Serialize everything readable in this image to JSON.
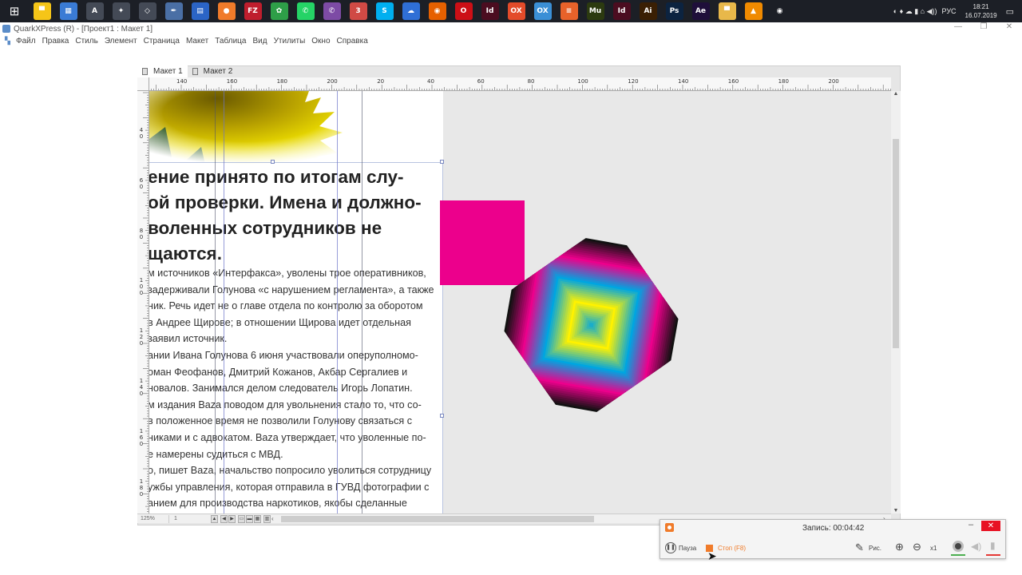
{
  "taskbar": {
    "icons": [
      {
        "name": "folder-icon",
        "color": "#f5c518",
        "glyph": "▀"
      },
      {
        "name": "tiles-icon",
        "color": "#3a7bd5",
        "glyph": "▦"
      },
      {
        "name": "a-app-icon",
        "color": "#444a56",
        "glyph": "A"
      },
      {
        "name": "gear-icon",
        "color": "#444a56",
        "glyph": "✦"
      },
      {
        "name": "cube-icon",
        "color": "#444a56",
        "glyph": "◇"
      },
      {
        "name": "feather-icon",
        "color": "#4a6fa5",
        "glyph": "✒"
      },
      {
        "name": "document-icon",
        "color": "#2b64c5",
        "glyph": "▤"
      },
      {
        "name": "recorder-app-icon",
        "color": "#f07b2a",
        "glyph": "●"
      },
      {
        "name": "filezilla-icon",
        "color": "#bf1e2d",
        "glyph": "FZ"
      },
      {
        "name": "cactus-icon",
        "color": "#2e9e48",
        "glyph": "✿"
      },
      {
        "name": "whatsapp-icon",
        "color": "#25d366",
        "glyph": "✆"
      },
      {
        "name": "viber-icon",
        "color": "#7d4ba5",
        "glyph": "✆"
      },
      {
        "name": "telegram-icon",
        "color": "#d04a45",
        "glyph": "3"
      },
      {
        "name": "skype-icon",
        "color": "#00aff0",
        "glyph": "S"
      },
      {
        "name": "cloud-icon",
        "color": "#2f6fd6",
        "glyph": "☁"
      },
      {
        "name": "firefox-icon",
        "color": "#e66000",
        "glyph": "◉"
      },
      {
        "name": "opera-icon",
        "color": "#cc0f16",
        "glyph": "O"
      },
      {
        "name": "indesign-icon",
        "color": "#4b0d20",
        "glyph": "Id"
      },
      {
        "name": "ox-icon",
        "color": "#e34b2a",
        "glyph": "OX"
      },
      {
        "name": "ox-blue-icon",
        "color": "#3b8fd6",
        "glyph": "OX"
      },
      {
        "name": "stripes-icon",
        "color": "#e8622a",
        "glyph": "≡"
      },
      {
        "name": "muse-icon",
        "color": "#2c3a10",
        "glyph": "Mu"
      },
      {
        "name": "indesign-2-icon",
        "color": "#4b0d20",
        "glyph": "Id"
      },
      {
        "name": "illustrator-icon",
        "color": "#3a1f04",
        "glyph": "Ai"
      },
      {
        "name": "photoshop-icon",
        "color": "#0c2340",
        "glyph": "Ps"
      },
      {
        "name": "after-effects-icon",
        "color": "#1f0f3a",
        "glyph": "Ae"
      },
      {
        "name": "explorer-icon",
        "color": "#e8b84a",
        "glyph": "▀"
      },
      {
        "name": "vlc-icon",
        "color": "#f08a00",
        "glyph": "▲"
      },
      {
        "name": "record-icon",
        "color": "#1c1f26",
        "glyph": "◉"
      }
    ],
    "tray": {
      "language": "РУС",
      "time": "18:21",
      "date": "16.07.2019"
    }
  },
  "window": {
    "title": "QuarkXPress (R) - [Проект1 : Макет 1]"
  },
  "menu": [
    "Файл",
    "Правка",
    "Стиль",
    "Элемент",
    "Страница",
    "Макет",
    "Таблица",
    "Вид",
    "Утилиты",
    "Окно",
    "Справка"
  ],
  "tabs": [
    "Макет 1",
    "Макет 2"
  ],
  "ruler": {
    "h_labels": [
      "140",
      "160",
      "180",
      "200",
      "20",
      "40",
      "60",
      "80",
      "100",
      "120",
      "140",
      "160",
      "180",
      "200"
    ],
    "v_labels": [
      "4 0",
      "6 0",
      "8 0",
      "1 0 0",
      "1 2 0",
      "1 4 0",
      "1 6 0",
      "1 8 0"
    ]
  },
  "article": {
    "headline": [
      "ение принято по итогам слу-",
      "ой проверки. Имена и должно-",
      "воленных сотрудников не",
      "щаются."
    ],
    "body": [
      "м источников «Интерфакса», уволены трое оперативников,",
      "задерживали Голунова «с нарушением регламента», а также",
      "ник. Речь идет не о главе отдела по контролю за оборотом",
      "в Андрее Щирове; в отношении Щирова идет отдельная",
      "заявил источник.",
      "ании Ивана Голунова 6 июня участвовали оперуполномо-",
      "оман Феофанов, Дмитрий Кожанов, Акбар Сергалиев и",
      "новалов. Занимался делом следователь Игорь Лопатин.",
      "м издания Baza поводом для увольнения стало то, что со-",
      "в положенное время не позволили Голунову связаться с",
      "никами и с адвокатом. Baza утверждает, что уволенные по-",
      "е намерены судиться с МВД.",
      "о, пишет Baza, начальство попросило уволиться сотрудницу",
      "ужбы управления, которая отправила в ГУВД фотографии с",
      "анием для производства наркотиков, якобы сделанные"
    ]
  },
  "colors": {
    "magenta": "#ec008c",
    "diamond": [
      "#111111",
      "#ec008c",
      "#00a5e0",
      "#fff200",
      "#00a5e0"
    ]
  },
  "statusbar": {
    "zoom": "125%",
    "page": "1"
  },
  "recorder": {
    "time": "Запись:  00:04:42",
    "pause": "Пауза",
    "stop": "Стоп (F8)",
    "draw": "Рис.",
    "zoom": "x1"
  }
}
